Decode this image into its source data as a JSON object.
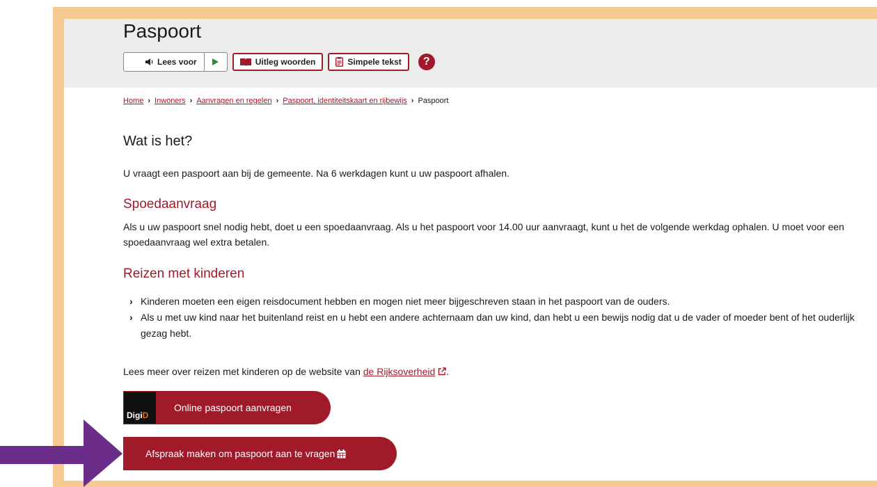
{
  "page": {
    "title": "Paspoort"
  },
  "toolbar": {
    "read_aloud_label": "Lees voor",
    "explain_words_label": "Uitleg woorden",
    "simple_text_label": "Simpele tekst",
    "help_label": "?"
  },
  "breadcrumb": {
    "items": [
      "Home",
      "Inwoners",
      "Aanvragen en regelen",
      "Paspoort, identiteitskaart en rijbewijs"
    ],
    "current": "Paspoort"
  },
  "content": {
    "heading": "Wat is het?",
    "intro": "U vraagt een paspoort aan bij de gemeente. Na 6 werkdagen kunt u uw paspoort afhalen.",
    "spoed_heading": "Spoedaanvraag",
    "spoed_text": "Als u uw paspoort snel nodig hebt, doet u een spoedaanvraag. Als u het paspoort voor 14.00 uur aanvraagt, kunt u het de volgende werkdag ophalen. U moet voor een spoedaanvraag wel extra betalen.",
    "kinderen_heading": "Reizen met kinderen",
    "kinderen_items": [
      "Kinderen moeten een eigen reisdocument hebben en mogen niet meer bijgeschreven staan in het paspoort van de ouders.",
      "Als u met uw kind naar het buitenland reist en u hebt een andere achternaam dan uw kind, dan hebt u een bewijs nodig dat u de vader of moeder bent of het ouderlijk gezag hebt."
    ],
    "read_more_prefix": "Lees meer over reizen met kinderen op de website van ",
    "read_more_link": "de Rijksoverheid",
    "read_more_suffix": "."
  },
  "buttons": {
    "online_label": "Online paspoort aanvragen",
    "digid_logo_text": "DigiD",
    "appointment_label": "Afspraak maken om paspoort aan te vragen"
  },
  "colors": {
    "accent": "#a11a2a",
    "frame": "#f6c993",
    "arrow": "#6b2c8a",
    "header_bg": "#ececec"
  }
}
